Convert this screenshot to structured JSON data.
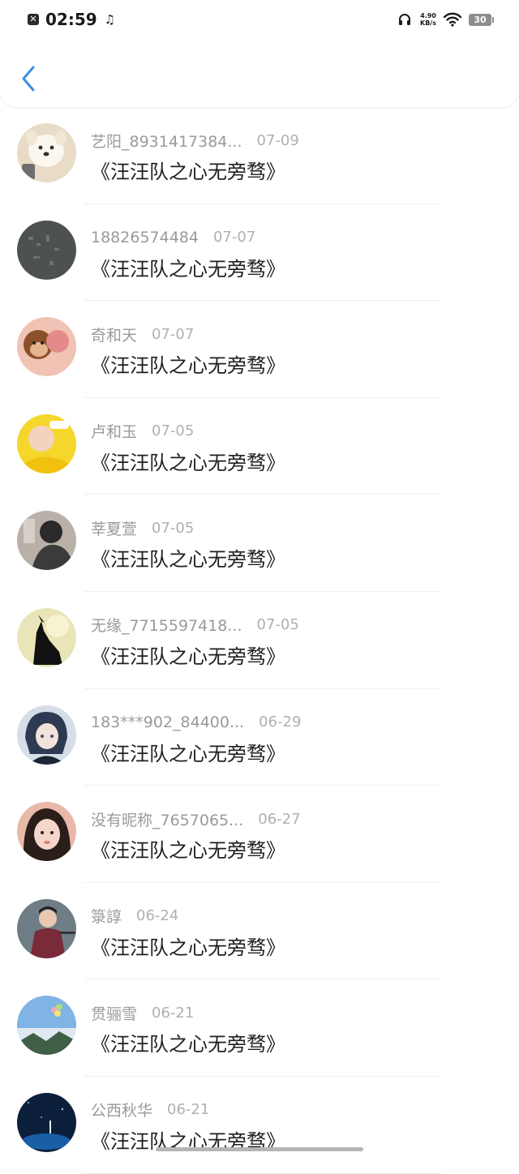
{
  "status_bar": {
    "time": "02:59",
    "app_badge": "✕",
    "music_icon": "♫",
    "net_speed_value": "4.90",
    "net_speed_unit": "KB/s",
    "battery": "30"
  },
  "header": {
    "back_icon": "chevron-left-icon",
    "accent_color": "#3a8ee6"
  },
  "items": [
    {
      "name": "艺阳_8931417384...",
      "date": "07-09",
      "title": "《汪汪队之心无旁骛》",
      "avatar": "avatar-dog"
    },
    {
      "name": "18826574484",
      "date": "07-07",
      "title": "《汪汪队之心无旁骛》",
      "avatar": "avatar-gray"
    },
    {
      "name": "奇和天",
      "date": "07-07",
      "title": "《汪汪队之心无旁骛》",
      "avatar": "avatar-monkeys"
    },
    {
      "name": "卢和玉",
      "date": "07-05",
      "title": "《汪汪队之心无旁骛》",
      "avatar": "avatar-yellow"
    },
    {
      "name": "莘夏萱",
      "date": "07-05",
      "title": "《汪汪队之心无旁骛》",
      "avatar": "avatar-dark-person"
    },
    {
      "name": "无缘_7715597418...",
      "date": "07-05",
      "title": "《汪汪队之心无旁骛》",
      "avatar": "avatar-wolf"
    },
    {
      "name": "183***902_84400...",
      "date": "06-29",
      "title": "《汪汪队之心无旁骛》",
      "avatar": "avatar-anime"
    },
    {
      "name": "没有昵称_7657065...",
      "date": "06-27",
      "title": "《汪汪队之心无旁骛》",
      "avatar": "avatar-girl"
    },
    {
      "name": "箓諄",
      "date": "06-24",
      "title": "《汪汪队之心无旁骛》",
      "avatar": "avatar-man"
    },
    {
      "name": "贯骊雪",
      "date": "06-21",
      "title": "《汪汪队之心无旁骛》",
      "avatar": "avatar-sky"
    },
    {
      "name": "公西秋华",
      "date": "06-21",
      "title": "《汪汪队之心无旁骛》",
      "avatar": "avatar-night"
    }
  ]
}
